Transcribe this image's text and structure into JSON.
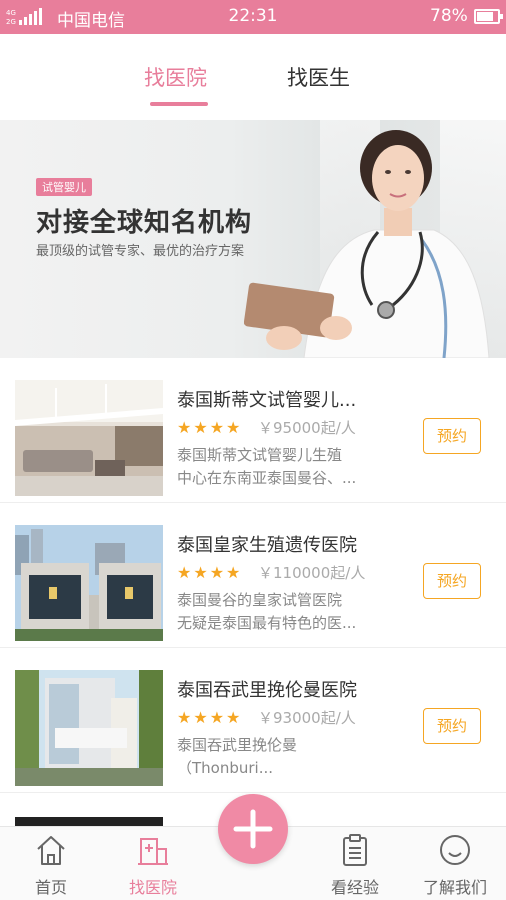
{
  "status_bar": {
    "network": "4G",
    "carrier": "中国电信",
    "time": "22:31",
    "battery": "78%",
    "battery_level": 0.78
  },
  "tabs": [
    {
      "label": "找医院",
      "active": true
    },
    {
      "label": "找医生",
      "active": false
    }
  ],
  "banner": {
    "tag": "试管婴儿",
    "title": "对接全球知名机构",
    "subtitle": "最顶级的试管专家、最优的治疗方案"
  },
  "hospitals": [
    {
      "name": "泰国斯蒂文试管婴儿...",
      "rating": 4,
      "stars": "★★★★",
      "price": "￥95000起/人",
      "desc_line1": "泰国斯蒂文试管婴儿生殖",
      "desc_line2": "中心在东南亚泰国曼谷、...",
      "button": "预约"
    },
    {
      "name": "泰国皇家生殖遗传医院",
      "rating": 4,
      "stars": "★★★★",
      "price": "￥110000起/人",
      "desc_line1": "泰国曼谷的皇家试管医院",
      "desc_line2": "无疑是泰国最有特色的医...",
      "button": "预约"
    },
    {
      "name": "泰国吞武里挽伦曼医院",
      "rating": 4,
      "stars": "★★★★",
      "price": "￥93000起/人",
      "desc_line1": "泰国吞武里挽伦曼",
      "desc_line2": "（Thonburi...",
      "button": "预约"
    }
  ],
  "bottom_nav": [
    {
      "label": "首页",
      "icon": "home-icon",
      "active": false
    },
    {
      "label": "找医院",
      "icon": "hospital-icon",
      "active": true
    },
    {
      "label": "",
      "icon": "plus-icon",
      "active": false
    },
    {
      "label": "看经验",
      "icon": "clipboard-icon",
      "active": false
    },
    {
      "label": "了解我们",
      "icon": "smile-icon",
      "active": false
    }
  ],
  "colors": {
    "accent": "#e87e9b",
    "star": "#f5a623",
    "plus_button": "#f08aa5"
  }
}
